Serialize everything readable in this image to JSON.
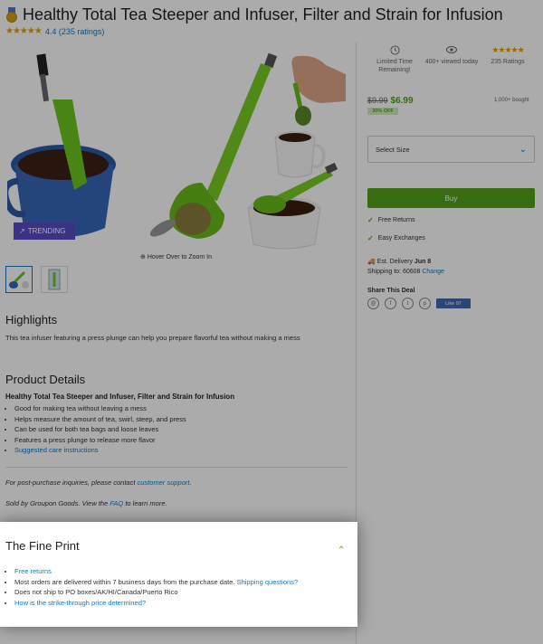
{
  "product": {
    "title": "Healthy Total Tea Steeper and Infuser, Filter and Strain for Infusion",
    "stars": "★★★★★",
    "rating_text": "4.4 (235 ratings)",
    "trending_label": "TRENDING",
    "zoom_hint": "Hover Over to Zoom In"
  },
  "stats": [
    {
      "label": "Limited Time Remaining!"
    },
    {
      "label": "400+ viewed today"
    },
    {
      "stars": "★★★★★",
      "label": "235 Ratings"
    }
  ],
  "pricing": {
    "old_price": "$9.99",
    "new_price": "$6.99",
    "discount": "30% OFF",
    "bought": "1,000+ bought"
  },
  "size_select": {
    "placeholder": "Select Size"
  },
  "buy_label": "Buy",
  "perks": [
    "Free Returns",
    "Easy Exchanges"
  ],
  "delivery": {
    "label": "Est. Delivery",
    "date": "Jun 8",
    "shipping_label": "Shipping to:",
    "zip": "60608",
    "change": "Change"
  },
  "share": {
    "title": "Share This Deal",
    "like": "Like 97"
  },
  "highlights": {
    "title": "Highlights",
    "text": "This tea infuser featuring a press plunge can help you prepare flavorful tea without making a mess"
  },
  "details": {
    "title": "Product Details",
    "heading": "Healthy Total Tea Steeper and Infuser, Filter and Strain for Infusion",
    "bullets": [
      "Good for making tea without leaving a mess",
      "Helps measure the amount of tea, swirl, steep, and press",
      "Can be used for both tea bags and loose leaves",
      "Features a press plunge to release more flavor"
    ],
    "care_link": "Suggested care instructions"
  },
  "support": {
    "prefix": "For post-purchase inquiries, please contact",
    "link": "customer support",
    "suffix": "."
  },
  "sold_by": {
    "prefix": "Sold by Groupon Goods. View the",
    "link": "FAQ",
    "suffix": "to learn more."
  },
  "fine_print": {
    "title": "The Fine Print",
    "free_returns": "Free returns",
    "delivery_text": "Most orders are delivered within 7 business days from the purchase date.",
    "shipping_link": "Shipping questions?",
    "no_ship": "Does not ship to PO boxes/AK/HI/Canada/Puerto Rico",
    "strike_link": "How is the strike-through price determined?"
  }
}
